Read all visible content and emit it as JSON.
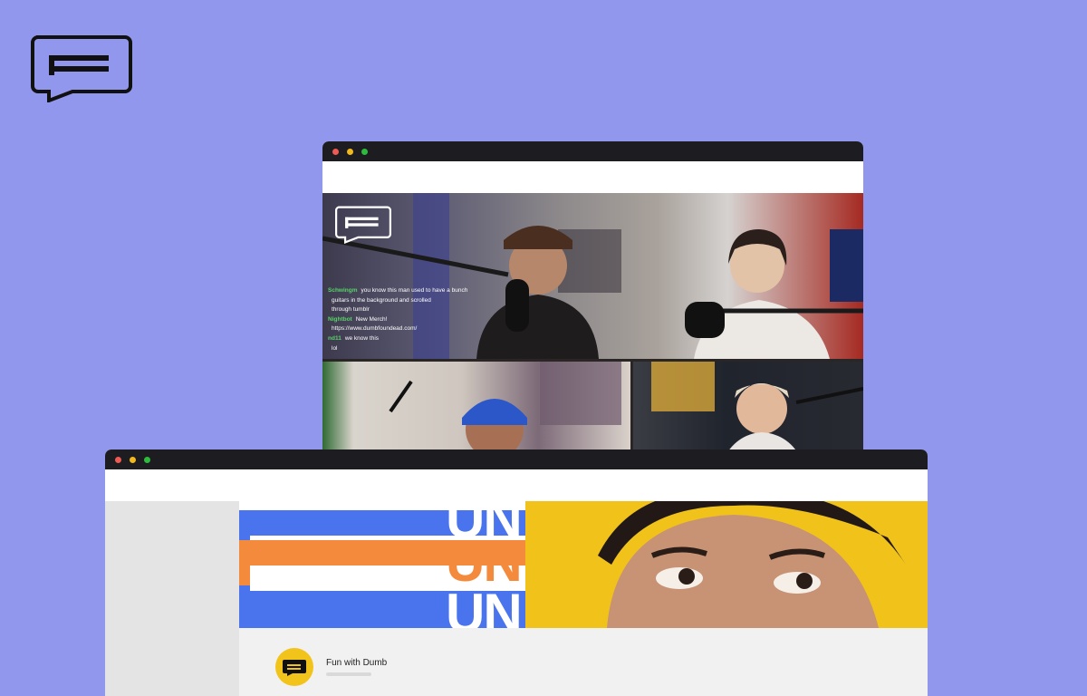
{
  "brand": {
    "logo_icon": "speech-bubble-f-logo-icon"
  },
  "back_window": {
    "controls": [
      "close",
      "minimize",
      "maximize"
    ],
    "stream": {
      "chat": [
        {
          "user": "Schwingm",
          "text": "you know this man used to have a bunch"
        },
        {
          "user": "",
          "text": "guitars in the background and scrolled"
        },
        {
          "user": "",
          "text": "through tumblr"
        },
        {
          "user": "Nightbot",
          "text": "New Merch!"
        },
        {
          "user": "",
          "text": "https://www.dumbfoundead.com/"
        },
        {
          "user": "nd11",
          "text": "we know this"
        },
        {
          "user": "",
          "text": "lol"
        }
      ]
    }
  },
  "front_window": {
    "banner": {
      "words": [
        "UN",
        "UN",
        "UN"
      ]
    },
    "channel": {
      "name": "Fun with Dumb"
    }
  }
}
